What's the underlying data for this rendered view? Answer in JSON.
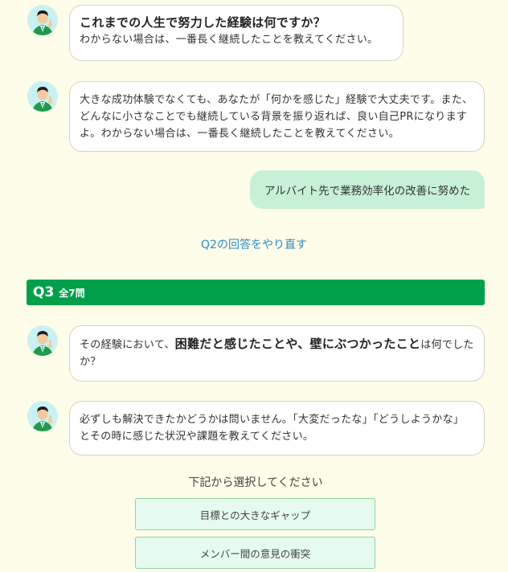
{
  "q2": {
    "question_title": "これまでの人生で努力した経験は何ですか？",
    "question_sub": "わからない場合は、一番長く継続したことを教えてください。",
    "hint_text": "大きな成功体験でなくても、あなたが「何かを感じた」経験で大丈夫です。また、どんなに小さなことでも継続している背景を振り返れば、良い自己PRになりますよ。わからない場合は、一番長く継続したことを教えてください。",
    "answer": "アルバイト先で業務効率化の改善に努めた",
    "redo_link": "Q2の回答をやり直す"
  },
  "q3": {
    "number": "Q3",
    "total": "全7問",
    "question_pre": "その経験において、",
    "question_strong": "困難だと感じたことや、壁にぶつかったこと",
    "question_post": "は何でしたか？",
    "hint_text": "必ずしも解決できたかどうかは問いません。「大変だったな」「どうしようかな」とその時に感じた状況や課題を教えてください。",
    "prompt": "下記から選択してください",
    "options": [
      "目標との大きなギャップ",
      "メンバー間の意見の衝突"
    ]
  },
  "colors": {
    "background": "#fdfde9",
    "accent_green": "#00a04a",
    "answer_bubble": "#c8f0d7",
    "link_blue": "#2a8cc7",
    "option_bg": "#e6fbef"
  },
  "icons": {
    "avatar": "advisor-avatar-icon"
  }
}
